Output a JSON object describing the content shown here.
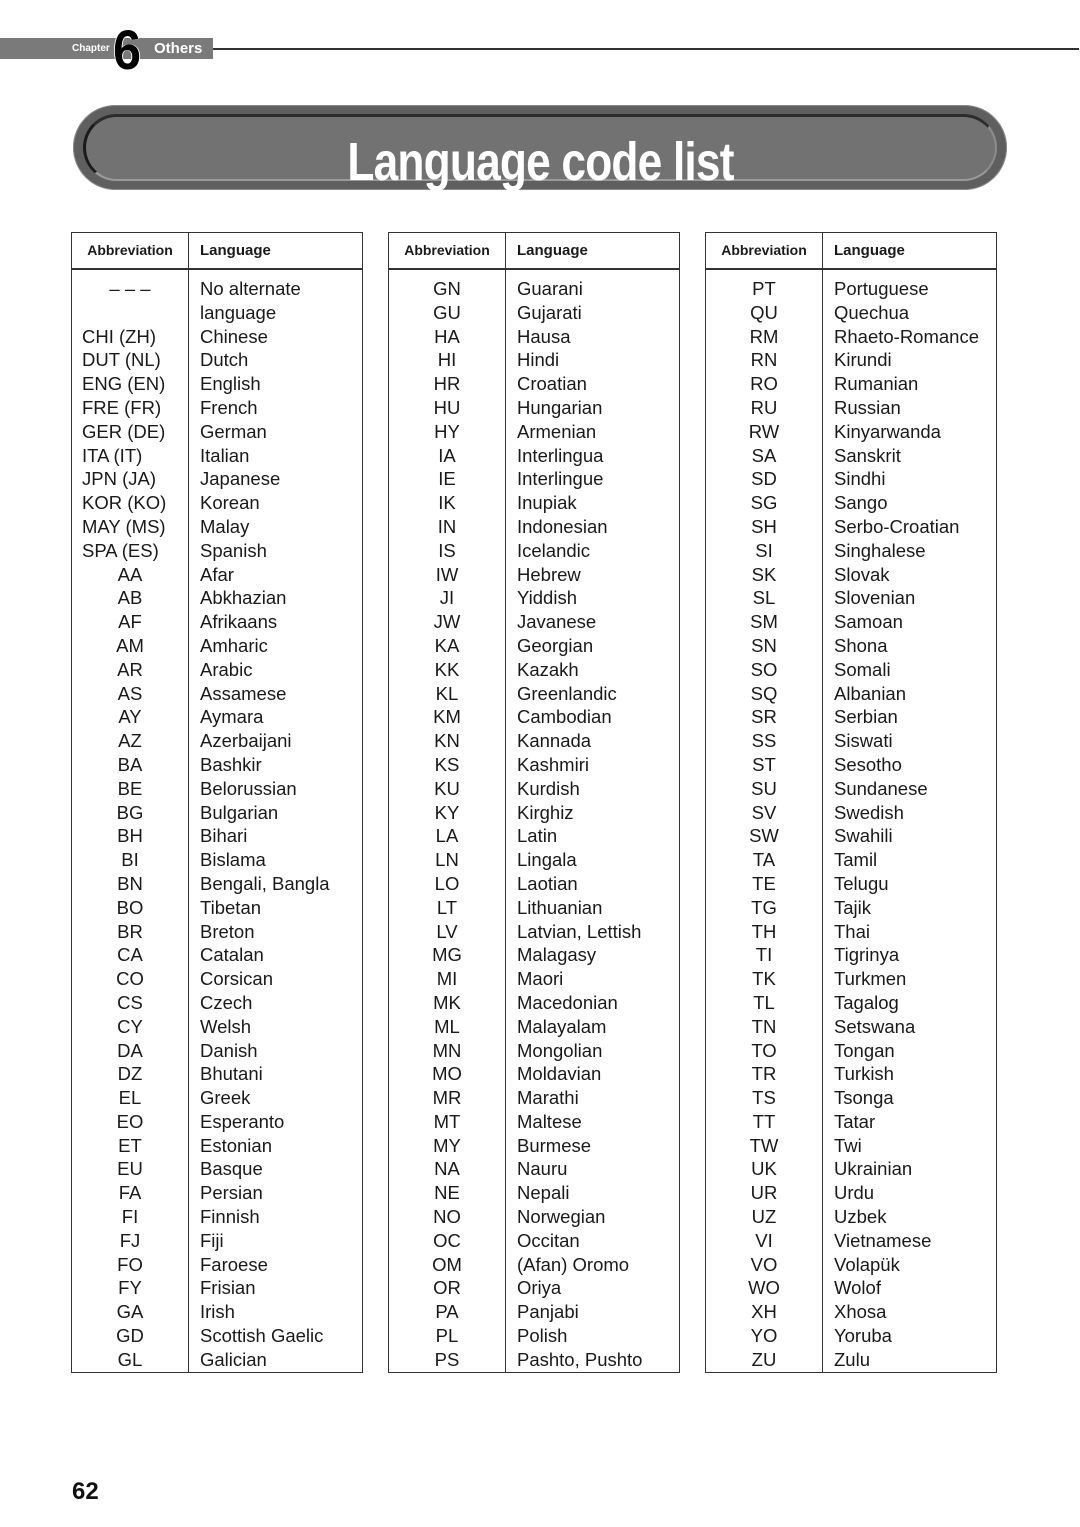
{
  "header": {
    "chapter_label": "Chapter",
    "chapter_number": "6",
    "chapter_title": "Others"
  },
  "page_title": "Language code list",
  "table_headers": {
    "abbreviation": "Abbreviation",
    "language": "Language"
  },
  "tables": [
    {
      "rows": [
        {
          "abbr": "– – –",
          "lang": "No alternate"
        },
        {
          "abbr": "",
          "lang": "language"
        },
        {
          "abbr": "CHI (ZH)",
          "lang": "Chinese"
        },
        {
          "abbr": "DUT (NL)",
          "lang": "Dutch"
        },
        {
          "abbr": "ENG (EN)",
          "lang": "English"
        },
        {
          "abbr": "FRE (FR)",
          "lang": "French"
        },
        {
          "abbr": "GER (DE)",
          "lang": "German"
        },
        {
          "abbr": "ITA (IT)",
          "lang": "Italian"
        },
        {
          "abbr": "JPN (JA)",
          "lang": "Japanese"
        },
        {
          "abbr": "KOR (KO)",
          "lang": "Korean"
        },
        {
          "abbr": "MAY (MS)",
          "lang": "Malay"
        },
        {
          "abbr": "SPA (ES)",
          "lang": "Spanish"
        },
        {
          "abbr": "AA",
          "lang": "Afar"
        },
        {
          "abbr": "AB",
          "lang": "Abkhazian"
        },
        {
          "abbr": "AF",
          "lang": "Afrikaans"
        },
        {
          "abbr": "AM",
          "lang": "Amharic"
        },
        {
          "abbr": "AR",
          "lang": "Arabic"
        },
        {
          "abbr": "AS",
          "lang": "Assamese"
        },
        {
          "abbr": "AY",
          "lang": "Aymara"
        },
        {
          "abbr": "AZ",
          "lang": "Azerbaijani"
        },
        {
          "abbr": "BA",
          "lang": "Bashkir"
        },
        {
          "abbr": "BE",
          "lang": "Belorussian"
        },
        {
          "abbr": "BG",
          "lang": "Bulgarian"
        },
        {
          "abbr": "BH",
          "lang": "Bihari"
        },
        {
          "abbr": "BI",
          "lang": "Bislama"
        },
        {
          "abbr": "BN",
          "lang": "Bengali, Bangla"
        },
        {
          "abbr": "BO",
          "lang": "Tibetan"
        },
        {
          "abbr": "BR",
          "lang": "Breton"
        },
        {
          "abbr": "CA",
          "lang": "Catalan"
        },
        {
          "abbr": "CO",
          "lang": "Corsican"
        },
        {
          "abbr": "CS",
          "lang": "Czech"
        },
        {
          "abbr": "CY",
          "lang": "Welsh"
        },
        {
          "abbr": "DA",
          "lang": "Danish"
        },
        {
          "abbr": "DZ",
          "lang": "Bhutani"
        },
        {
          "abbr": "EL",
          "lang": "Greek"
        },
        {
          "abbr": "EO",
          "lang": "Esperanto"
        },
        {
          "abbr": "ET",
          "lang": "Estonian"
        },
        {
          "abbr": "EU",
          "lang": "Basque"
        },
        {
          "abbr": "FA",
          "lang": "Persian"
        },
        {
          "abbr": "FI",
          "lang": "Finnish"
        },
        {
          "abbr": "FJ",
          "lang": "Fiji"
        },
        {
          "abbr": "FO",
          "lang": "Faroese"
        },
        {
          "abbr": "FY",
          "lang": "Frisian"
        },
        {
          "abbr": "GA",
          "lang": "Irish"
        },
        {
          "abbr": "GD",
          "lang": "Scottish Gaelic"
        },
        {
          "abbr": "GL",
          "lang": "Galician"
        }
      ]
    },
    {
      "rows": [
        {
          "abbr": "GN",
          "lang": "Guarani"
        },
        {
          "abbr": "GU",
          "lang": "Gujarati"
        },
        {
          "abbr": "HA",
          "lang": "Hausa"
        },
        {
          "abbr": "HI",
          "lang": "Hindi"
        },
        {
          "abbr": "HR",
          "lang": "Croatian"
        },
        {
          "abbr": "HU",
          "lang": "Hungarian"
        },
        {
          "abbr": "HY",
          "lang": "Armenian"
        },
        {
          "abbr": "IA",
          "lang": "Interlingua"
        },
        {
          "abbr": "IE",
          "lang": "Interlingue"
        },
        {
          "abbr": "IK",
          "lang": "Inupiak"
        },
        {
          "abbr": "IN",
          "lang": "Indonesian"
        },
        {
          "abbr": "IS",
          "lang": "Icelandic"
        },
        {
          "abbr": "IW",
          "lang": "Hebrew"
        },
        {
          "abbr": "JI",
          "lang": "Yiddish"
        },
        {
          "abbr": "JW",
          "lang": "Javanese"
        },
        {
          "abbr": "KA",
          "lang": "Georgian"
        },
        {
          "abbr": "KK",
          "lang": "Kazakh"
        },
        {
          "abbr": "KL",
          "lang": "Greenlandic"
        },
        {
          "abbr": "KM",
          "lang": "Cambodian"
        },
        {
          "abbr": "KN",
          "lang": "Kannada"
        },
        {
          "abbr": "KS",
          "lang": "Kashmiri"
        },
        {
          "abbr": "KU",
          "lang": "Kurdish"
        },
        {
          "abbr": "KY",
          "lang": "Kirghiz"
        },
        {
          "abbr": "LA",
          "lang": "Latin"
        },
        {
          "abbr": "LN",
          "lang": "Lingala"
        },
        {
          "abbr": "LO",
          "lang": "Laotian"
        },
        {
          "abbr": "LT",
          "lang": "Lithuanian"
        },
        {
          "abbr": "LV",
          "lang": "Latvian, Lettish"
        },
        {
          "abbr": "MG",
          "lang": "Malagasy"
        },
        {
          "abbr": "MI",
          "lang": "Maori"
        },
        {
          "abbr": "MK",
          "lang": "Macedonian"
        },
        {
          "abbr": "ML",
          "lang": "Malayalam"
        },
        {
          "abbr": "MN",
          "lang": "Mongolian"
        },
        {
          "abbr": "MO",
          "lang": "Moldavian"
        },
        {
          "abbr": "MR",
          "lang": "Marathi"
        },
        {
          "abbr": "MT",
          "lang": "Maltese"
        },
        {
          "abbr": "MY",
          "lang": "Burmese"
        },
        {
          "abbr": "NA",
          "lang": "Nauru"
        },
        {
          "abbr": "NE",
          "lang": "Nepali"
        },
        {
          "abbr": "NO",
          "lang": "Norwegian"
        },
        {
          "abbr": "OC",
          "lang": "Occitan"
        },
        {
          "abbr": "OM",
          "lang": "(Afan) Oromo"
        },
        {
          "abbr": "OR",
          "lang": "Oriya"
        },
        {
          "abbr": "PA",
          "lang": "Panjabi"
        },
        {
          "abbr": "PL",
          "lang": "Polish"
        },
        {
          "abbr": "PS",
          "lang": "Pashto, Pushto"
        }
      ]
    },
    {
      "rows": [
        {
          "abbr": "PT",
          "lang": "Portuguese"
        },
        {
          "abbr": "QU",
          "lang": "Quechua"
        },
        {
          "abbr": "RM",
          "lang": "Rhaeto-Romance"
        },
        {
          "abbr": "RN",
          "lang": "Kirundi"
        },
        {
          "abbr": "RO",
          "lang": "Rumanian"
        },
        {
          "abbr": "RU",
          "lang": "Russian"
        },
        {
          "abbr": "RW",
          "lang": "Kinyarwanda"
        },
        {
          "abbr": "SA",
          "lang": "Sanskrit"
        },
        {
          "abbr": "SD",
          "lang": "Sindhi"
        },
        {
          "abbr": "SG",
          "lang": "Sango"
        },
        {
          "abbr": "SH",
          "lang": "Serbo-Croatian"
        },
        {
          "abbr": "SI",
          "lang": "Singhalese"
        },
        {
          "abbr": "SK",
          "lang": "Slovak"
        },
        {
          "abbr": "SL",
          "lang": "Slovenian"
        },
        {
          "abbr": "SM",
          "lang": "Samoan"
        },
        {
          "abbr": "SN",
          "lang": "Shona"
        },
        {
          "abbr": "SO",
          "lang": "Somali"
        },
        {
          "abbr": "SQ",
          "lang": "Albanian"
        },
        {
          "abbr": "SR",
          "lang": "Serbian"
        },
        {
          "abbr": "SS",
          "lang": "Siswati"
        },
        {
          "abbr": "ST",
          "lang": "Sesotho"
        },
        {
          "abbr": "SU",
          "lang": "Sundanese"
        },
        {
          "abbr": "SV",
          "lang": "Swedish"
        },
        {
          "abbr": "SW",
          "lang": "Swahili"
        },
        {
          "abbr": "TA",
          "lang": "Tamil"
        },
        {
          "abbr": "TE",
          "lang": "Telugu"
        },
        {
          "abbr": "TG",
          "lang": "Tajik"
        },
        {
          "abbr": "TH",
          "lang": "Thai"
        },
        {
          "abbr": "TI",
          "lang": "Tigrinya"
        },
        {
          "abbr": "TK",
          "lang": "Turkmen"
        },
        {
          "abbr": "TL",
          "lang": "Tagalog"
        },
        {
          "abbr": "TN",
          "lang": "Setswana"
        },
        {
          "abbr": "TO",
          "lang": "Tongan"
        },
        {
          "abbr": "TR",
          "lang": "Turkish"
        },
        {
          "abbr": "TS",
          "lang": "Tsonga"
        },
        {
          "abbr": "TT",
          "lang": "Tatar"
        },
        {
          "abbr": "TW",
          "lang": "Twi"
        },
        {
          "abbr": "UK",
          "lang": "Ukrainian"
        },
        {
          "abbr": "UR",
          "lang": "Urdu"
        },
        {
          "abbr": "UZ",
          "lang": "Uzbek"
        },
        {
          "abbr": "VI",
          "lang": "Vietnamese"
        },
        {
          "abbr": "VO",
          "lang": "Volapük"
        },
        {
          "abbr": "WO",
          "lang": "Wolof"
        },
        {
          "abbr": "XH",
          "lang": "Xhosa"
        },
        {
          "abbr": "YO",
          "lang": "Yoruba"
        },
        {
          "abbr": "ZU",
          "lang": "Zulu"
        }
      ]
    }
  ],
  "page_number": "62"
}
